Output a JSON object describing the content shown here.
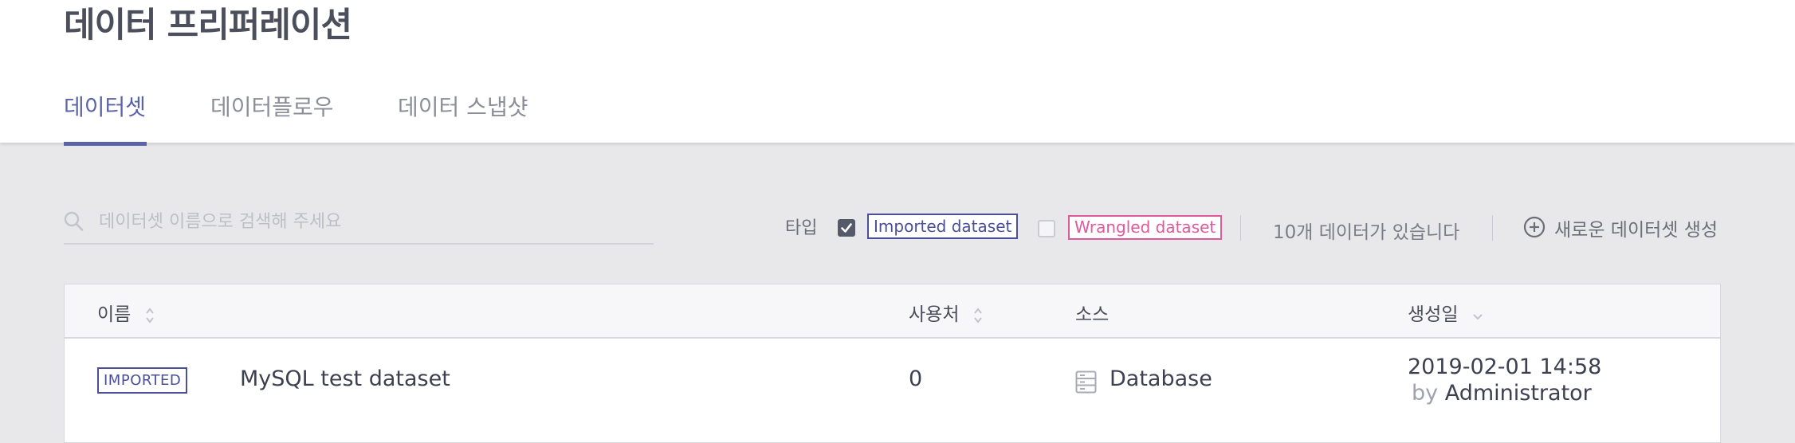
{
  "header": {
    "title": "데이터 프리퍼레이션",
    "tabs": [
      {
        "label": "데이터셋",
        "active": true
      },
      {
        "label": "데이터플로우",
        "active": false
      },
      {
        "label": "데이터 스냅샷",
        "active": false
      }
    ]
  },
  "toolbar": {
    "search_placeholder": "데이터셋 이름으로 검색해 주세요",
    "search_value": "",
    "type_label": "타입",
    "filters": [
      {
        "label": "Imported dataset",
        "checked": true,
        "color": "#4a4f98"
      },
      {
        "label": "Wrangled dataset",
        "checked": false,
        "color": "#e0599a"
      }
    ],
    "count_text": "10개 데이터가 있습니다",
    "new_dataset_label": "새로운 데이터셋 생성"
  },
  "table": {
    "columns": [
      "이름",
      "사용처",
      "소스",
      "생성일"
    ],
    "rows": [
      {
        "type_badge": "IMPORTED",
        "name": "MySQL test dataset",
        "usage": "0",
        "source": "Database",
        "created": "2019-02-01 14:58",
        "by_word": "by",
        "created_by": "Administrator"
      }
    ]
  },
  "icons": {
    "search": "search-icon",
    "checkbox": "check-icon",
    "new": "plus-circle-icon",
    "sort": "sort-icon",
    "source": "database-icon"
  },
  "colors": {
    "accent": "#5b63a8",
    "imported": "#4a4f98",
    "wrangled": "#e0599a"
  }
}
